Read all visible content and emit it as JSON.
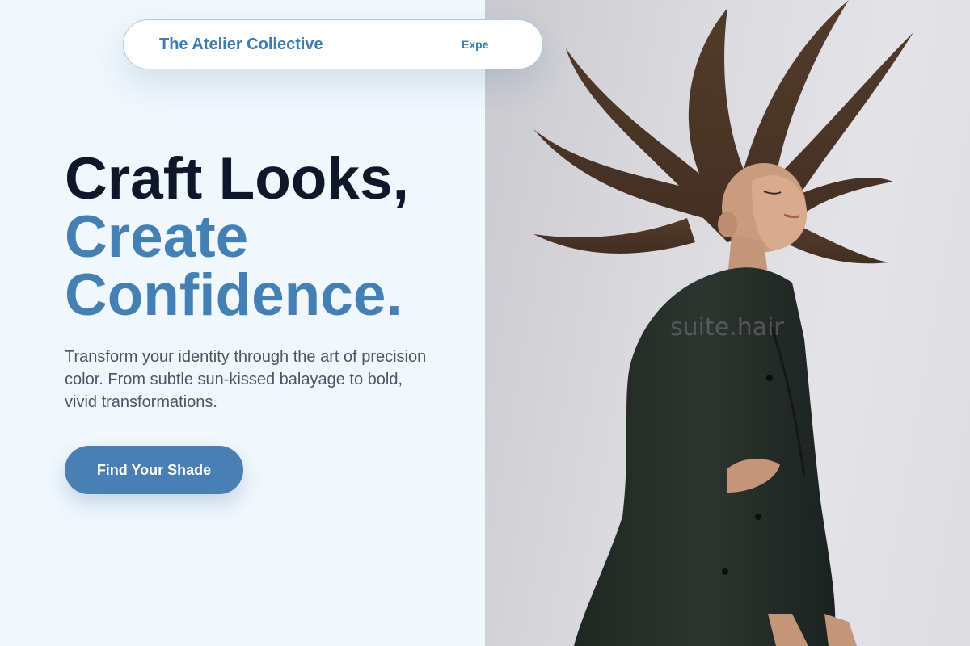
{
  "nav": {
    "brand": "The Atelier Collective",
    "link_partial": "Expe"
  },
  "hero": {
    "title_line1": "Craft Looks,",
    "title_line2": "Create",
    "title_line3": "Confidence.",
    "description": "Transform your identity through the art of precision color. From subtle sun-kissed balayage to bold, vivid transformations.",
    "cta_label": "Find Your Shade"
  },
  "photo": {
    "watermark": "suite.hair"
  },
  "colors": {
    "background": "#f0f7fd",
    "brand": "#3f7cb0",
    "accent_text": "#4580b4",
    "heading": "#0f172a",
    "cta": "#4a7fb3"
  }
}
